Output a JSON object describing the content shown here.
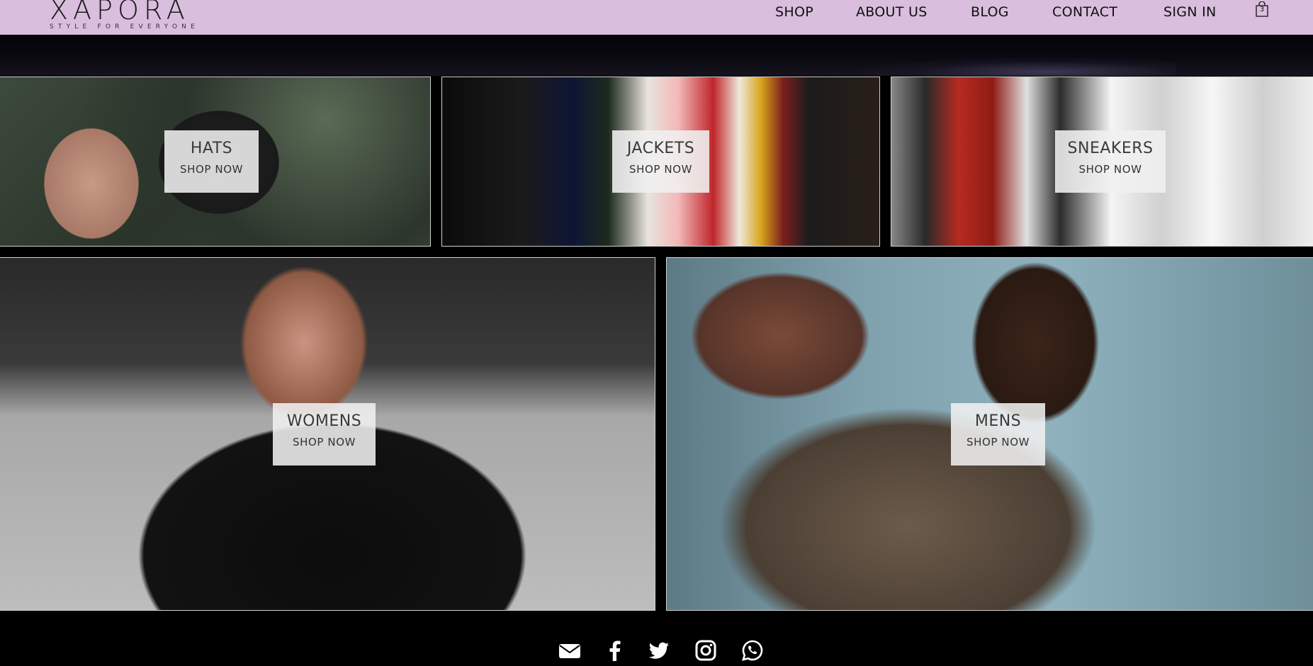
{
  "brand": {
    "name": "XAPORA",
    "tagline": "STYLE FOR EVERYONE"
  },
  "nav": {
    "shop": "SHOP",
    "about": "ABOUT US",
    "blog": "BLOG",
    "contact": "CONTACT",
    "signin": "SIGN IN"
  },
  "cart": {
    "count": "3"
  },
  "categories": {
    "hats": {
      "title": "HATS",
      "cta": "SHOP NOW"
    },
    "jackets": {
      "title": "JACKETS",
      "cta": "SHOP NOW"
    },
    "sneakers": {
      "title": "SNEAKERS",
      "cta": "SHOP NOW"
    },
    "womens": {
      "title": "WOMENS",
      "cta": "SHOP NOW"
    },
    "mens": {
      "title": "MENS",
      "cta": "SHOP NOW"
    }
  },
  "footer": {
    "icons": [
      "envelope-icon",
      "facebook-icon",
      "twitter-icon",
      "instagram-icon",
      "whatsapp-icon"
    ]
  },
  "colors": {
    "header_bg": "#d9bedd",
    "page_bg": "#000000",
    "label_bg": "#f0f0f0"
  }
}
